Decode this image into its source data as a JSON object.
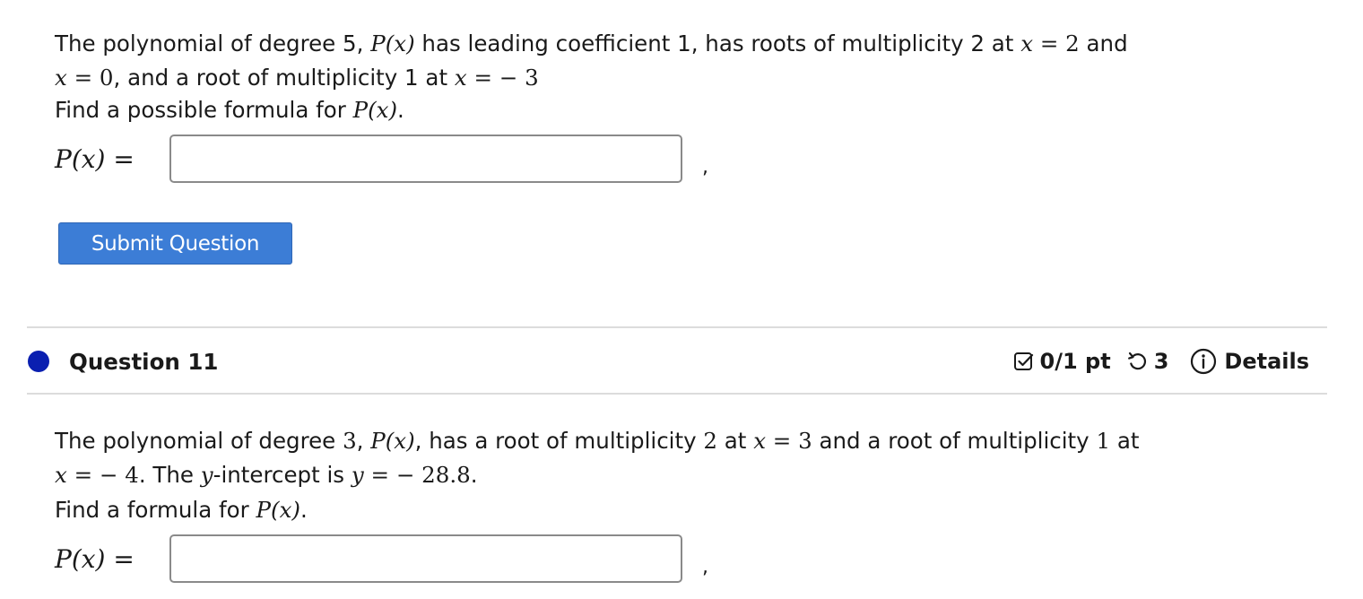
{
  "question10": {
    "line1_a": "The polynomial of degree 5, ",
    "line1_px": "P(x)",
    "line1_b": " has leading coefficient 1, has roots of multiplicity 2 at ",
    "line1_x": "x",
    "line1_eq": " = 2",
    "line1_c": " and",
    "line2_x": "x",
    "line2_eq": " = 0",
    "line2_b": ", and a root of multiplicity 1 at ",
    "line2_x2": "x",
    "line2_eq2": " =  − 3",
    "line3_a": "Find a possible formula for ",
    "line3_px": "P(x)",
    "line3_b": ".",
    "answer_label": "P(x) =",
    "answer_value": "",
    "comma": ","
  },
  "submit_label": "Submit Question",
  "question11": {
    "title": "Question 11",
    "score": "0/1 pt",
    "attempts": "3",
    "details": "Details",
    "line1_a": "The polynomial of degree ",
    "line1_deg": "3",
    "line1_b": ", ",
    "line1_px": "P(x)",
    "line1_c": ", has a root of multiplicity ",
    "line1_m": "2",
    "line1_d": " at ",
    "line1_x": "x",
    "line1_eq": " = 3",
    "line1_e": " and a root of multiplicity ",
    "line1_m2": "1",
    "line1_f": " at",
    "line2_x": "x",
    "line2_eq": " =  − 4",
    "line2_b": ". The ",
    "line2_y": "y",
    "line2_c": "-intercept is ",
    "line2_y2": "y",
    "line2_eq2": " =  − 28.8",
    "line2_d": ".",
    "line3_a": "Find a formula for ",
    "line3_px": "P(x)",
    "line3_b": ".",
    "answer_label": "P(x) =",
    "answer_value": "",
    "comma": ","
  },
  "colors": {
    "submit_bg": "#3c7dd6",
    "status_dot": "#0a1fb0",
    "divider": "#dcdcdc"
  },
  "icons": [
    "checkbox-icon",
    "retry-icon",
    "info-icon"
  ]
}
